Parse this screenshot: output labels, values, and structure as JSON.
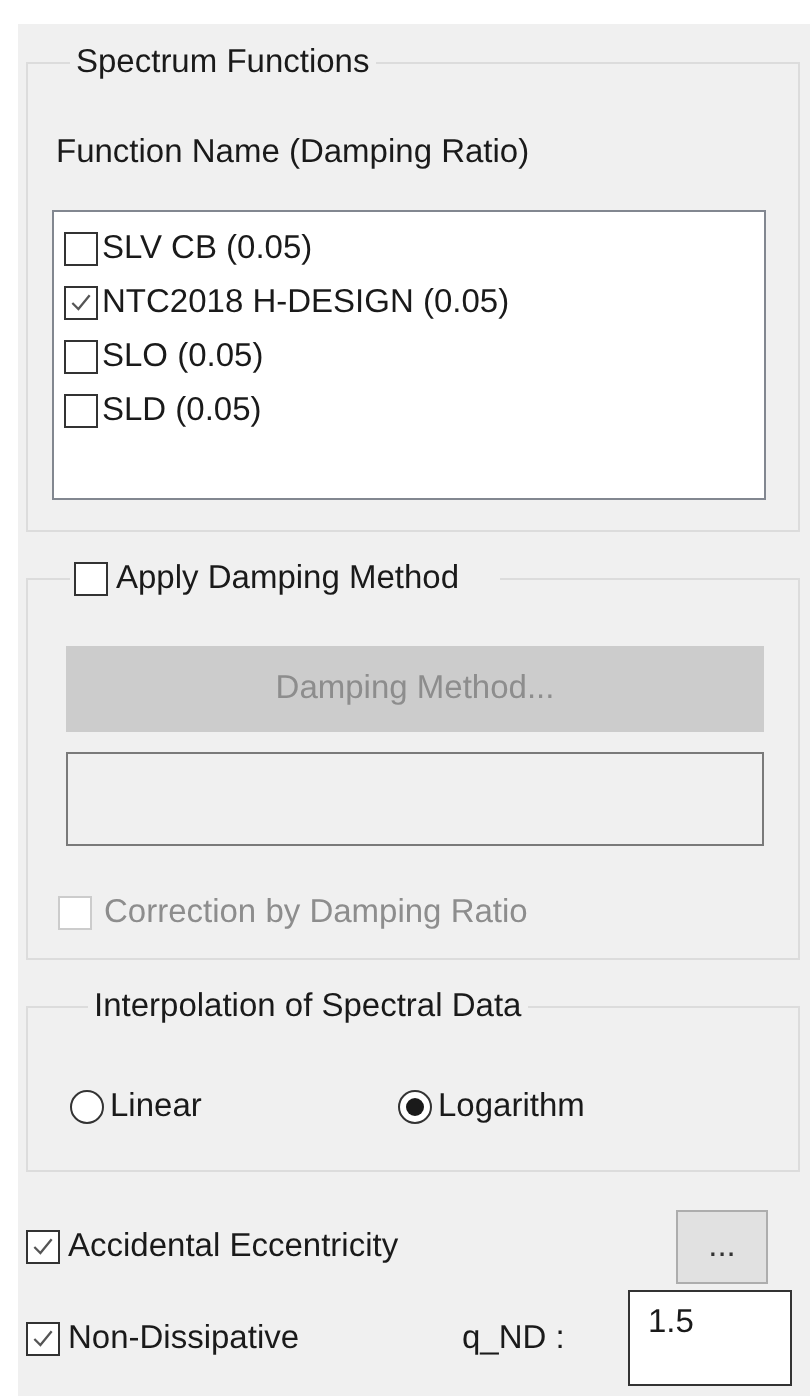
{
  "spectrum_functions": {
    "title": "Spectrum Functions",
    "list_label": "Function Name (Damping Ratio)",
    "functions": [
      {
        "label": "SLV CB (0.05)",
        "checked": false
      },
      {
        "label": "NTC2018 H-DESIGN (0.05)",
        "checked": true
      },
      {
        "label": "SLO (0.05)",
        "checked": false
      },
      {
        "label": "SLD (0.05)",
        "checked": false
      }
    ]
  },
  "damping": {
    "label": "Apply Damping Method",
    "checked": false,
    "button": "Damping Method...",
    "disabled": true,
    "correction": {
      "label": "Correction by Damping Ratio",
      "checked": false,
      "disabled": true
    }
  },
  "interpolation": {
    "title": "Interpolation of Spectral Data",
    "options": [
      {
        "label": "Linear",
        "selected": false
      },
      {
        "label": "Logarithm",
        "selected": true
      }
    ]
  },
  "accidental_eccentricity": {
    "label": "Accidental Eccentricity",
    "checked": true,
    "button": "..."
  },
  "non_dissipative": {
    "label": "Non-Dissipative",
    "checked": true,
    "field_label": "q_ND :",
    "value": "1.5"
  }
}
